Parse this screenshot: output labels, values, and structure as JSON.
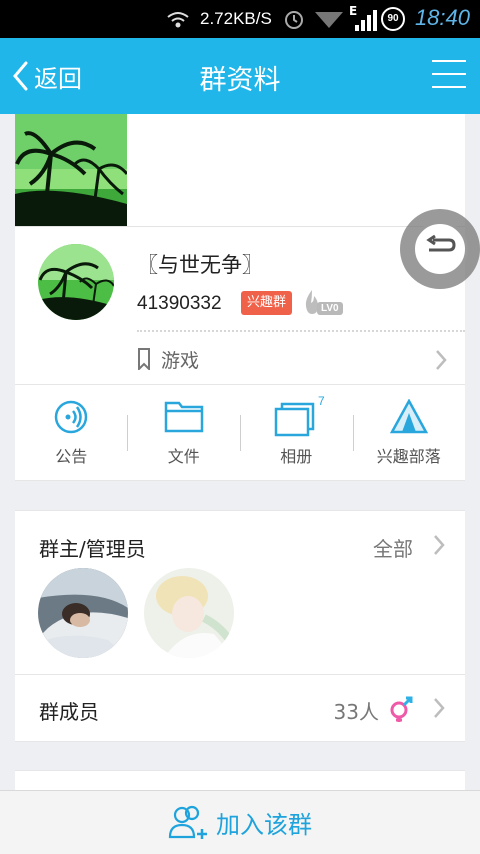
{
  "status_bar": {
    "speed": "2.72KB/S",
    "battery": "90",
    "network": "E",
    "time": "18:40"
  },
  "header": {
    "back_label": "返回",
    "title": "群资料"
  },
  "group": {
    "name": "〖与世无争〗",
    "id": "41390332",
    "badge": "兴趣群",
    "level": "LV0",
    "category": "游戏"
  },
  "functions": [
    {
      "label": "公告",
      "icon": "announcement-icon"
    },
    {
      "label": "文件",
      "icon": "folder-icon"
    },
    {
      "label": "相册",
      "icon": "album-icon",
      "count": "7"
    },
    {
      "label": "兴趣部落",
      "icon": "tent-icon"
    }
  ],
  "admins": {
    "label": "群主/管理员",
    "all_label": "全部"
  },
  "members": {
    "label": "群成员",
    "count": "33人"
  },
  "footer": {
    "join_label": "加入该群"
  },
  "colors": {
    "accent": "#20b6ea",
    "badge": "#f0614a",
    "join": "#1fa3dc"
  }
}
